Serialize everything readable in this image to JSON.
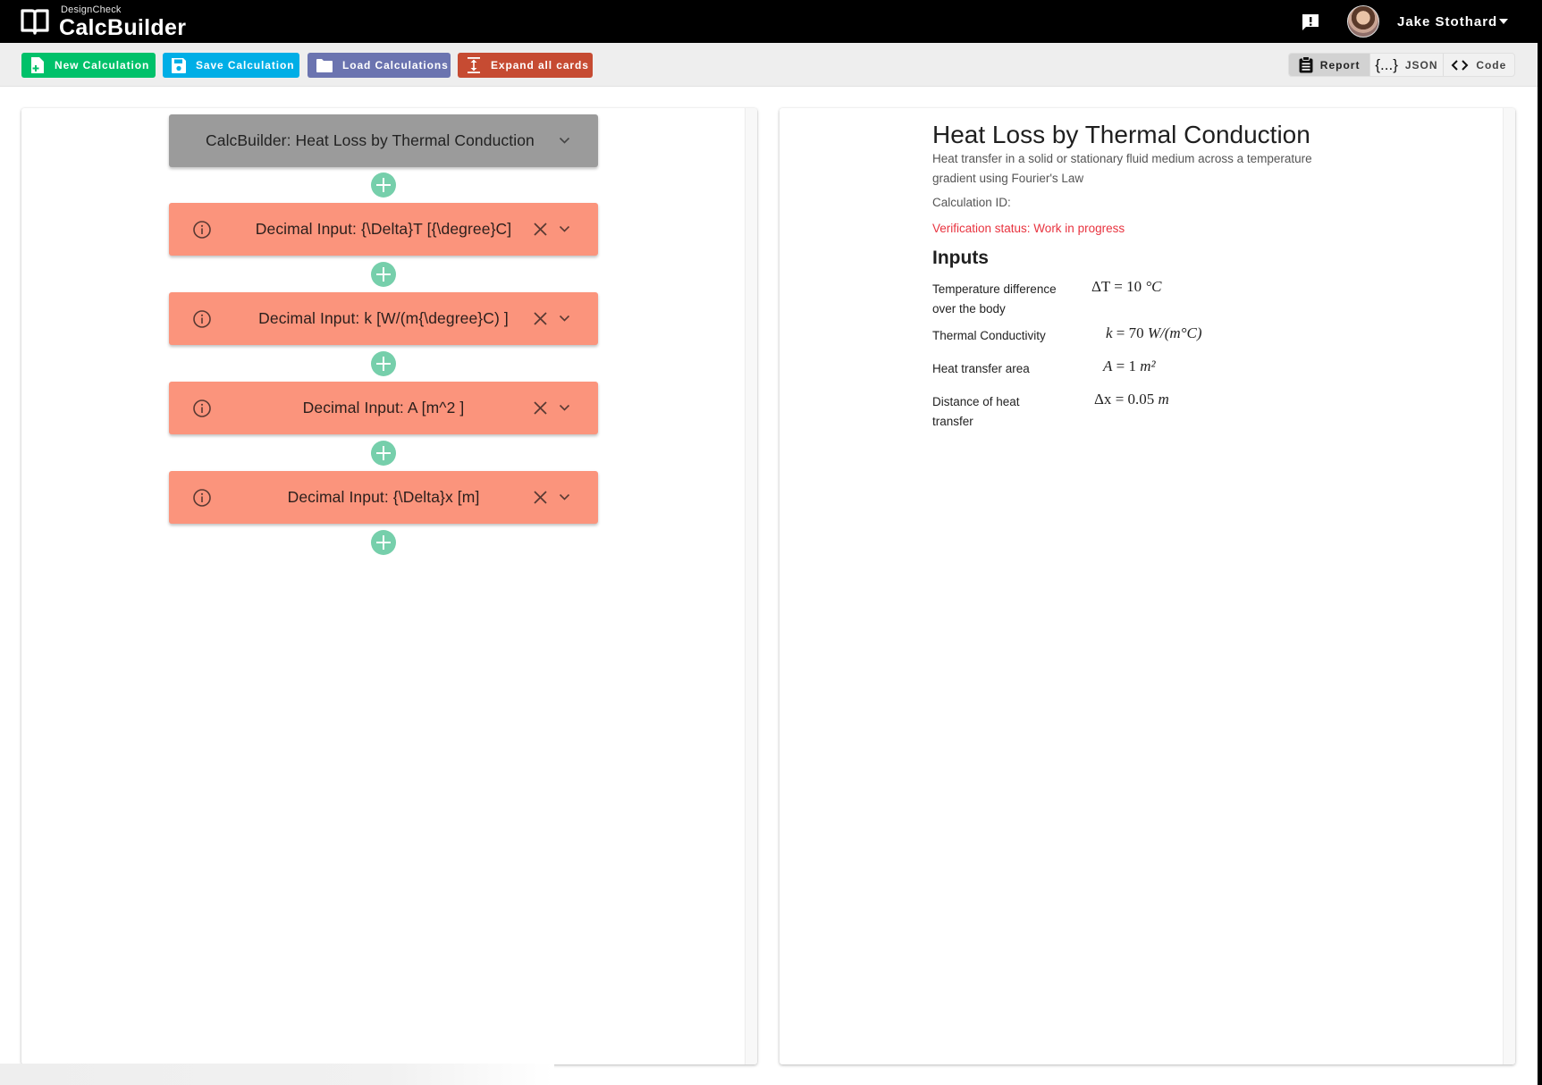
{
  "header": {
    "brand_small": "DesignCheck",
    "brand_name": "CalcBuilder",
    "user_name": "Jake Stothard",
    "icons": {
      "logo": "book-open-icon",
      "feedback": "feedback-icon",
      "user_menu": "caret-down-icon"
    }
  },
  "toolbar": {
    "buttons": [
      {
        "label": "New Calculation",
        "icon": "file-plus-icon",
        "color": "#00c16a"
      },
      {
        "label": "Save Calculation",
        "icon": "floppy-disk-icon",
        "color": "#00aee6"
      },
      {
        "label": "Load Calculations",
        "icon": "folder-icon",
        "color": "#6b74b0"
      },
      {
        "label": "Expand all cards",
        "icon": "expand-vertical-icon",
        "color": "#c64b32"
      }
    ],
    "view_toggle": {
      "selected": "Report",
      "options": [
        {
          "label": "Report",
          "icon": "clipboard-icon"
        },
        {
          "label": "JSON",
          "icon": "braces-icon",
          "glyph": "{...}"
        },
        {
          "label": "Code",
          "icon": "code-icon"
        }
      ]
    }
  },
  "builder": {
    "header_card": {
      "title": "CalcBuilder: Heat Loss by Thermal Conduction",
      "color": "#9b9b9b"
    },
    "cards": [
      {
        "title": "Decimal Input: {\\Delta}T [{\\degree}C]"
      },
      {
        "title": "Decimal Input: k [W/(m{\\degree}C) ]"
      },
      {
        "title": "Decimal Input: A [m^2 ]"
      },
      {
        "title": "Decimal Input: {\\Delta}x [m]"
      }
    ],
    "card_color": "#fb947c",
    "add_button_color": "#76cfab"
  },
  "report": {
    "title": "Heat Loss by Thermal Conduction",
    "description": "Heat transfer in a solid or stationary fluid medium across a temperature gradient using Fourier's Law",
    "calculation_id_label": "Calculation ID:",
    "calculation_id": "",
    "verification_status": "Verification status: Work in progress",
    "status_color": "#e8333f",
    "inputs_heading": "Inputs",
    "inputs": [
      {
        "label": "Temperature difference over the body",
        "symbol": "ΔT",
        "value": "10",
        "unit": "°C"
      },
      {
        "label": "Thermal Conductivity",
        "symbol": "k",
        "value": "70",
        "unit": "W/(m°C)"
      },
      {
        "label": "Heat transfer area",
        "symbol": "A",
        "value": "1",
        "unit": "m²"
      },
      {
        "label": "Distance of heat transfer",
        "symbol": "Δx",
        "value": "0.05",
        "unit": "m"
      }
    ]
  }
}
